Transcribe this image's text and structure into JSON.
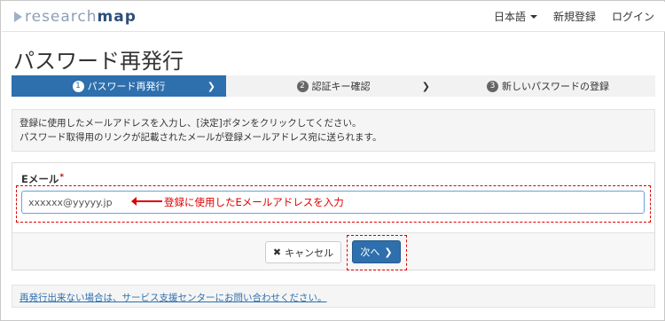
{
  "header": {
    "logo_prefix": "research",
    "logo_suffix": "map",
    "language_label": "日本語",
    "register_label": "新規登録",
    "login_label": "ログイン"
  },
  "page": {
    "title": "パスワード再発行"
  },
  "steps": [
    {
      "num": "1",
      "label": "パスワード再発行",
      "active": true
    },
    {
      "num": "2",
      "label": "認証キー確認",
      "active": false
    },
    {
      "num": "3",
      "label": "新しいパスワードの登録",
      "active": false
    }
  ],
  "info": {
    "line1": "登録に使用したメールアドレスを入力し、[決定]ボタンをクリックしてください。",
    "line2": "パスワード取得用のリンクが記載されたメールが登録メールアドレス宛に送られます。"
  },
  "form": {
    "email_label": "Eメール",
    "required_mark": "*",
    "email_value": "xxxxxx@yyyyy.jp",
    "annotation": "登録に使用したEメールアドレスを入力",
    "cancel_label": "キャンセル",
    "next_label": "次へ"
  },
  "footer": {
    "link_text": "再発行出来ない場合は、サービス支援センターにお問い合わせください。"
  },
  "colors": {
    "primary": "#2e6fad",
    "annotation_red": "#dd0000"
  }
}
